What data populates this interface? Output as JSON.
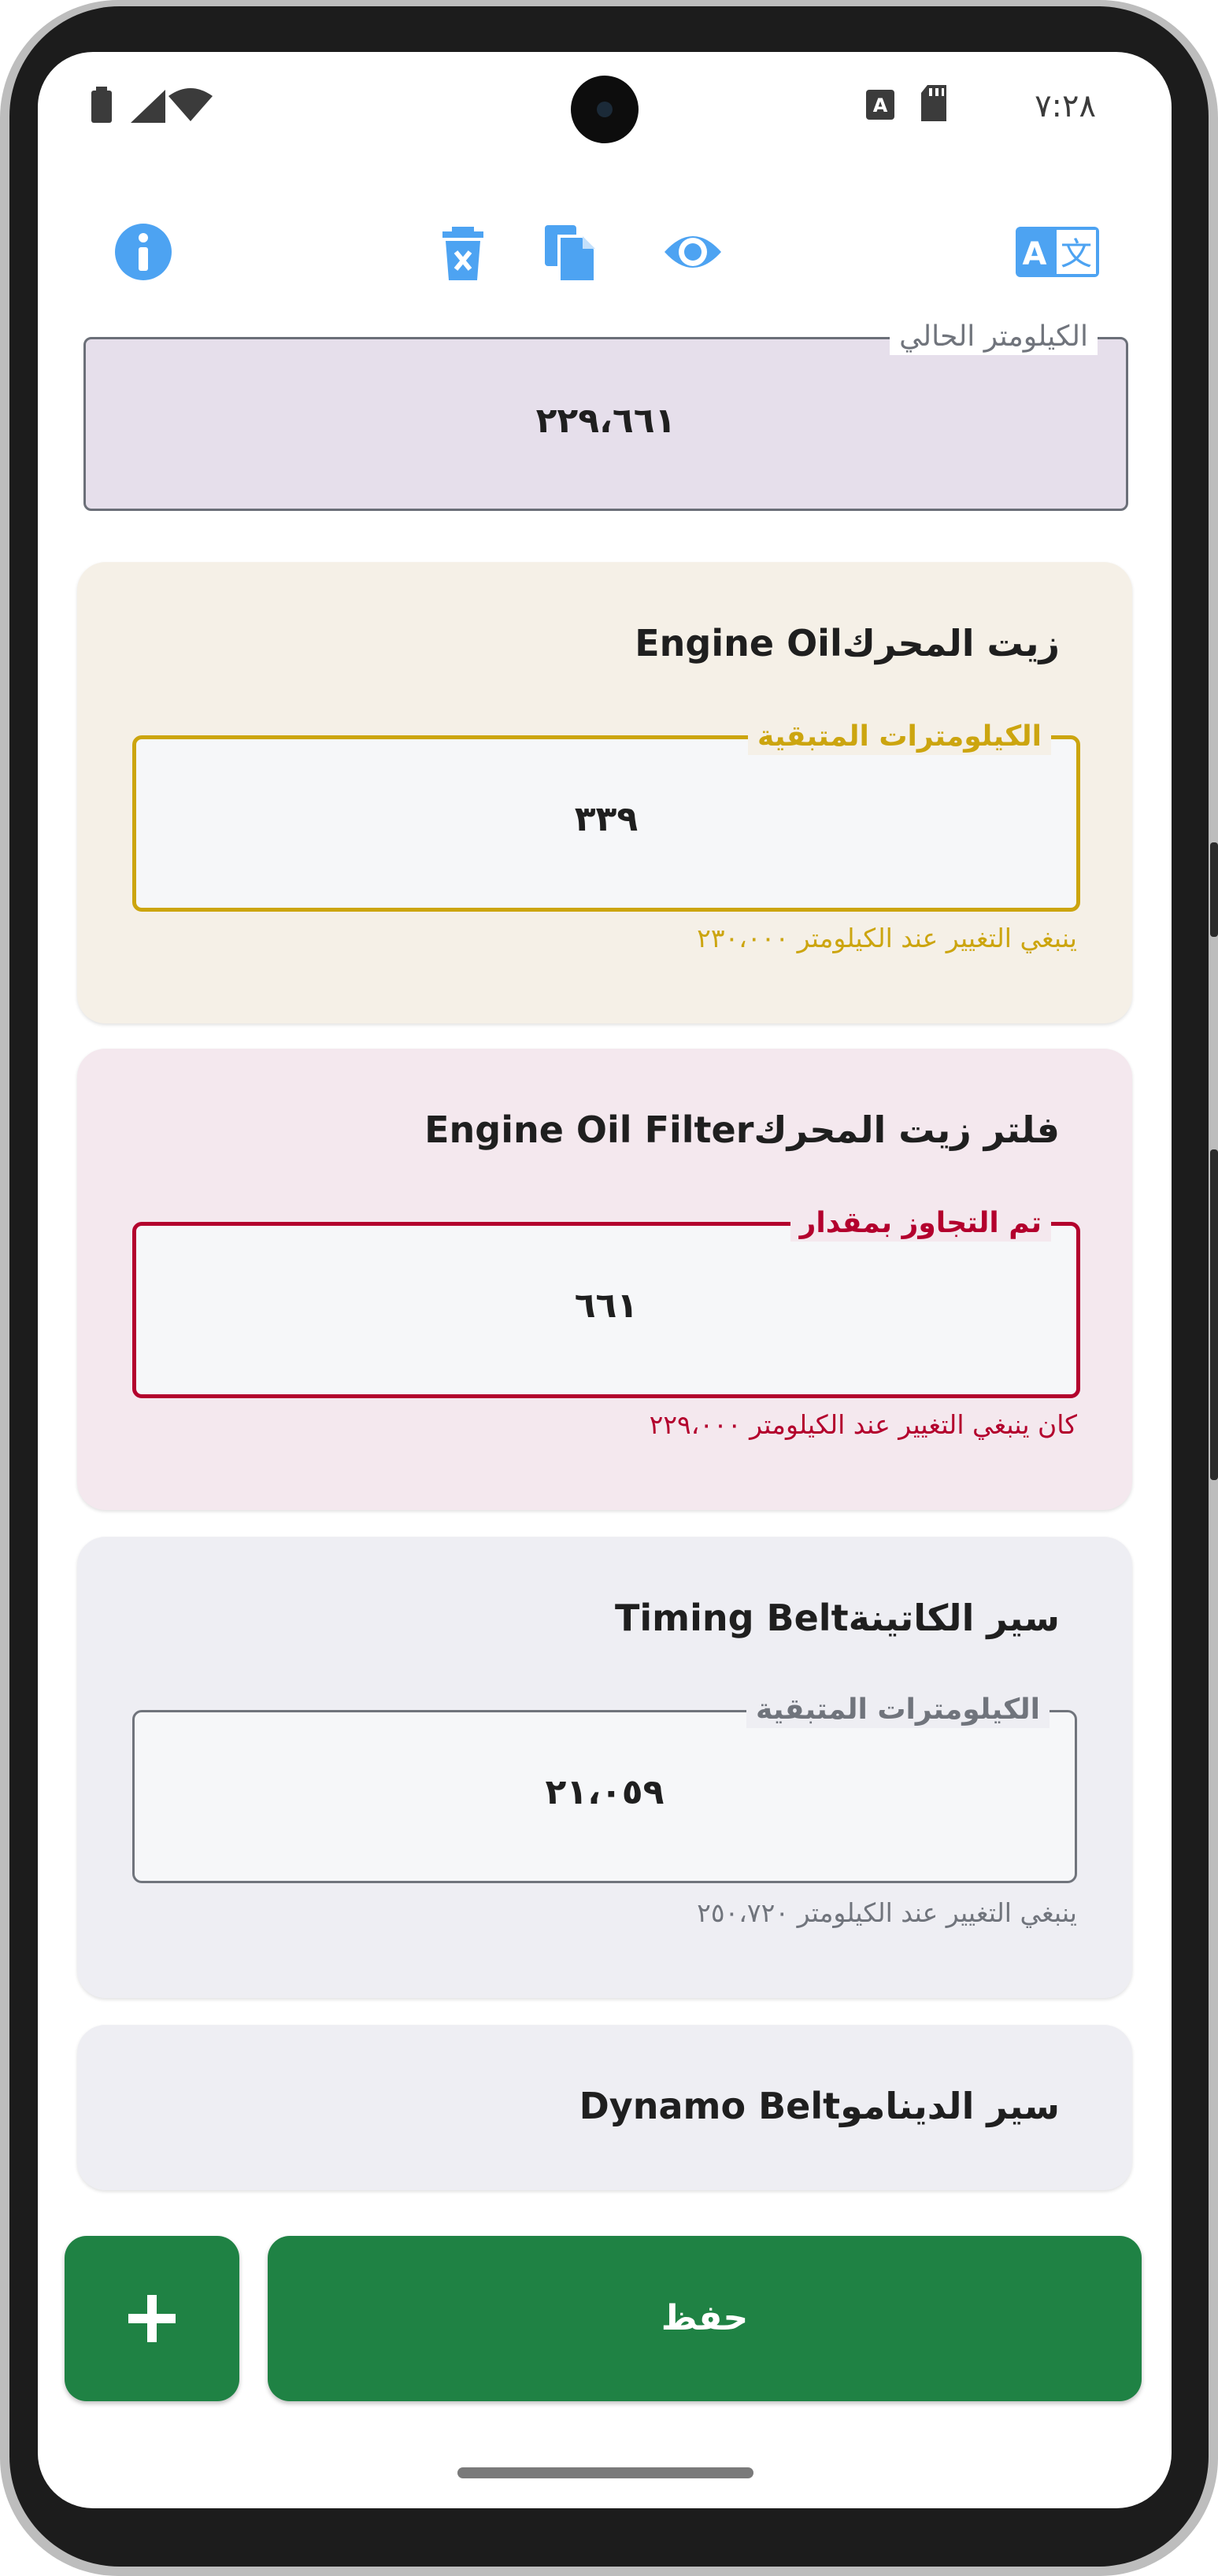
{
  "status_bar": {
    "time": "٧:٢٨",
    "icons": [
      "battery-icon",
      "signal-icon",
      "wifi-icon",
      "keyboard-indicator-icon",
      "sd-card-icon"
    ]
  },
  "toolbar": {
    "icons": [
      "info-icon",
      "delete-icon",
      "copy-icon",
      "view-icon",
      "translate-icon"
    ],
    "accent": "#4da3f2"
  },
  "current_km": {
    "label": "الكيلومتر الحالي",
    "value": "٢٢٩،٦٦١"
  },
  "items": [
    {
      "title_en": "Engine Oil",
      "title_ar": "زيت المحرك",
      "field_label": "الكيلومترات المتبقية",
      "value": "٣٣٩",
      "helper": "ينبغي التغيير عند الكيلومتر ٢٣٠،٠٠٠",
      "status": "warning",
      "card_color": "#f5f0e7",
      "accent": "#cca50f"
    },
    {
      "title_en": "Engine Oil Filter",
      "title_ar": "فلتر زيت المحرك",
      "field_label": "تم التجاوز بمقدار",
      "value": "٦٦١",
      "helper": "كان ينبغي التغيير عند الكيلومتر ٢٢٩،٠٠٠",
      "status": "overdue",
      "card_color": "#f4e8ee",
      "accent": "#b3002d"
    },
    {
      "title_en": "Timing Belt",
      "title_ar": "سير الكاتينة",
      "field_label": "الكيلومترات المتبقية",
      "value": "٢١،٠٥٩",
      "helper": "ينبغي التغيير عند الكيلومتر ٢٥٠،٧٢٠",
      "status": "ok",
      "card_color": "#eeeef3",
      "accent": "#70747c"
    },
    {
      "title_en": "Dynamo Belt",
      "title_ar": "سير الدينامو",
      "card_color": "#eeeef3"
    }
  ],
  "actions": {
    "add_label": "+",
    "save_label": "حفظ",
    "color": "#1f8244"
  }
}
